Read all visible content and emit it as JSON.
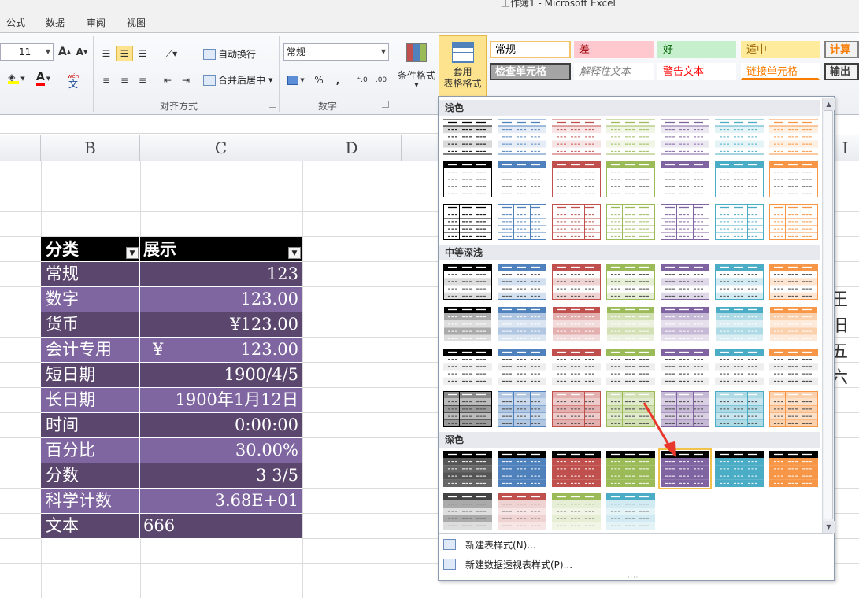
{
  "window_title": "工作簿1 - Microsoft Excel",
  "tabs": [
    "公式",
    "数据",
    "审阅",
    "视图"
  ],
  "ribbon": {
    "font_size": "11",
    "grow_font": "A",
    "shrink_font": "A",
    "font_color_letter": "A",
    "phonetic": "wén",
    "wrap_text": "自动换行",
    "merge_center": "合并后居中",
    "number_format": "常规",
    "percent": "%",
    "comma": ",",
    "align_group": "对齐方式",
    "number_group": "数字",
    "conditional_format": "条件格式",
    "table_format": [
      "套用",
      "表格格式"
    ],
    "cell_styles": [
      {
        "label": "常规",
        "bg": "#ffffff",
        "color": "#000000",
        "border": "#f5c46a"
      },
      {
        "label": "差",
        "bg": "#ffc7ce",
        "color": "#9c0006",
        "border": "#ffc7ce"
      },
      {
        "label": "好",
        "bg": "#c6efce",
        "color": "#006100",
        "border": "#c6efce"
      },
      {
        "label": "适中",
        "bg": "#ffeb9c",
        "color": "#9c6500",
        "border": "#ffeb9c"
      },
      {
        "label": "计算",
        "bg": "#f2f2f2",
        "color": "#fa7d00",
        "border": "#7f7f7f"
      },
      {
        "label": "检查单元格",
        "bg": "#a5a5a5",
        "color": "#ffffff",
        "border": "#3f3f3f"
      },
      {
        "label": "解释性文本",
        "bg": "#ffffff",
        "color": "#7f7f7f",
        "border": "#ffffff"
      },
      {
        "label": "警告文本",
        "bg": "#ffffff",
        "color": "#ff0000",
        "border": "#ffffff"
      },
      {
        "label": "链接单元格",
        "bg": "#ffffff",
        "color": "#fa7d00",
        "border": "#ffffff"
      },
      {
        "label": "输出",
        "bg": "#f2f2f2",
        "color": "#3f3f3f",
        "border": "#3f3f3f"
      }
    ]
  },
  "columns": [
    "B",
    "C",
    "D",
    "I"
  ],
  "table": {
    "headers": [
      "分类",
      "展示"
    ],
    "rows": [
      [
        "常规",
        "123"
      ],
      [
        "数字",
        "123.00"
      ],
      [
        "货币",
        "¥123.00"
      ],
      [
        "会计专用",
        "¥",
        "123.00"
      ],
      [
        "短日期",
        "1900/4/5"
      ],
      [
        "长日期",
        "1900年1月12日"
      ],
      [
        "时间",
        "0:00:00"
      ],
      [
        "百分比",
        "30.00%"
      ],
      [
        "分数",
        "3 3/5"
      ],
      [
        "科学计数",
        "3.68E+01"
      ],
      [
        "文本",
        "666"
      ]
    ]
  },
  "gallery": {
    "sections": [
      "浅色",
      "中等深浅",
      "深色"
    ],
    "palette": [
      "#000000",
      "#4f81bd",
      "#c0504d",
      "#9bbb59",
      "#8064a2",
      "#4bacc6",
      "#f79646"
    ],
    "menu": [
      "新建表样式(N)...",
      "新建数据透视表样式(P)..."
    ]
  },
  "right_edge_text": [
    "王",
    "旧",
    "五",
    "六"
  ]
}
